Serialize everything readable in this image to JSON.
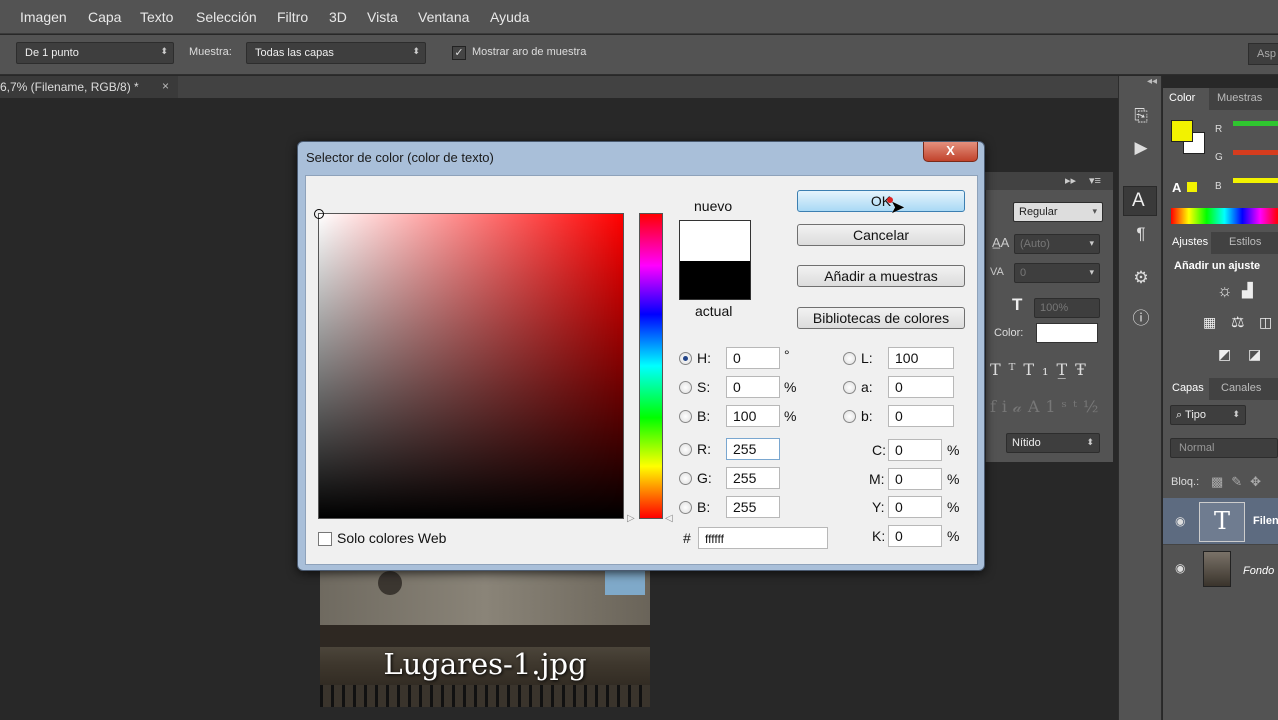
{
  "menu": [
    "Imagen",
    "Capa",
    "Texto",
    "Selección",
    "Filtro",
    "3D",
    "Vista",
    "Ventana",
    "Ayuda"
  ],
  "options": {
    "sample_size": "De 1 punto",
    "sample_label": "Muestra:",
    "sample_value": "Todas las capas",
    "show_ring_label": "Mostrar aro de muestra",
    "right_button": "Asp"
  },
  "document_tab": {
    "title": "6,7% (Filename, RGB/8) *",
    "close": "×"
  },
  "canvas": {
    "image_caption": "Lugares-1.jpg"
  },
  "character_panel": {
    "font_style": "Regular",
    "leading": "(Auto)",
    "tracking": "0",
    "scale": "100%",
    "color_label": "Color:",
    "antialias": "Nítido"
  },
  "right_panels": {
    "color_tab": "Color",
    "swatches_tab": "Muestras",
    "r": "R",
    "g": "G",
    "b": "B",
    "adjust_tab": "Ajustes",
    "styles_tab": "Estilos",
    "adjust_heading": "Añadir un ajuste",
    "layers_tab": "Capas",
    "channels_tab": "Canales",
    "kind_filter": "Tipo",
    "blend_mode": "Normal",
    "lock_label": "Bloq.:",
    "layer1_name": "Filen",
    "layer2_name": "Fondo"
  },
  "dialog": {
    "title": "Selector de color (color de texto)",
    "close": "X",
    "new_label": "nuevo",
    "current_label": "actual",
    "ok": "OK",
    "cancel": "Cancelar",
    "add_swatch": "Añadir a muestras",
    "libraries": "Bibliotecas de colores",
    "web_only": "Solo colores Web",
    "new_color": "#ffffff",
    "current_color": "#000000",
    "H": "0",
    "S": "0",
    "B": "100",
    "R": "255",
    "G": "255",
    "Bv": "255",
    "L": "100",
    "a": "0",
    "b": "0",
    "C": "0",
    "M": "0",
    "Y": "0",
    "K": "0",
    "hex": "ffffff",
    "deg": "°",
    "pct": "%",
    "hash": "#",
    "labels": {
      "H": "H:",
      "S": "S:",
      "B": "B:",
      "R": "R:",
      "G": "G:",
      "Bb": "B:",
      "L": "L:",
      "a": "a:",
      "b": "b:",
      "C": "C:",
      "M": "M:",
      "Y": "Y:",
      "K": "K:"
    }
  },
  "colors": {
    "fg_swatch": "#f2f200",
    "bg_swatch": "#ffffff"
  }
}
